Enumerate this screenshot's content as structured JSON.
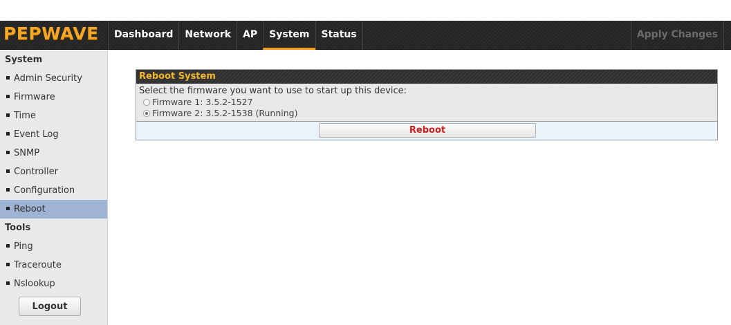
{
  "brand": {
    "logo_text": "PEPWAVE",
    "logo_color": "#f5a623"
  },
  "nav": {
    "items": [
      {
        "label": "Dashboard",
        "active": false
      },
      {
        "label": "Network",
        "active": false
      },
      {
        "label": "AP",
        "active": false
      },
      {
        "label": "System",
        "active": true
      },
      {
        "label": "Status",
        "active": false
      }
    ],
    "apply_label": "Apply Changes"
  },
  "sidebar": {
    "system_heading": "System",
    "system_items": [
      {
        "label": "Admin Security",
        "active": false
      },
      {
        "label": "Firmware",
        "active": false
      },
      {
        "label": "Time",
        "active": false
      },
      {
        "label": "Event Log",
        "active": false
      },
      {
        "label": "SNMP",
        "active": false
      },
      {
        "label": "Controller",
        "active": false
      },
      {
        "label": "Configuration",
        "active": false
      },
      {
        "label": "Reboot",
        "active": true
      }
    ],
    "tools_heading": "Tools",
    "tools_items": [
      {
        "label": "Ping"
      },
      {
        "label": "Traceroute"
      },
      {
        "label": "Nslookup"
      }
    ],
    "logout_label": "Logout"
  },
  "reboot": {
    "title": "Reboot System",
    "description": "Select the firmware you want to use to start up this device:",
    "firmware_options": [
      {
        "label": "Firmware 1: 3.5.2-1527",
        "checked": false
      },
      {
        "label": "Firmware 2: 3.5.2-1538 (Running)",
        "checked": true
      }
    ],
    "button_label": "Reboot",
    "button_text_color": "#cc1f1f"
  },
  "colors": {
    "accent": "#f39c12",
    "sidebar_active": "#9fb3d4",
    "panel_footer": "#eaf3fc"
  }
}
